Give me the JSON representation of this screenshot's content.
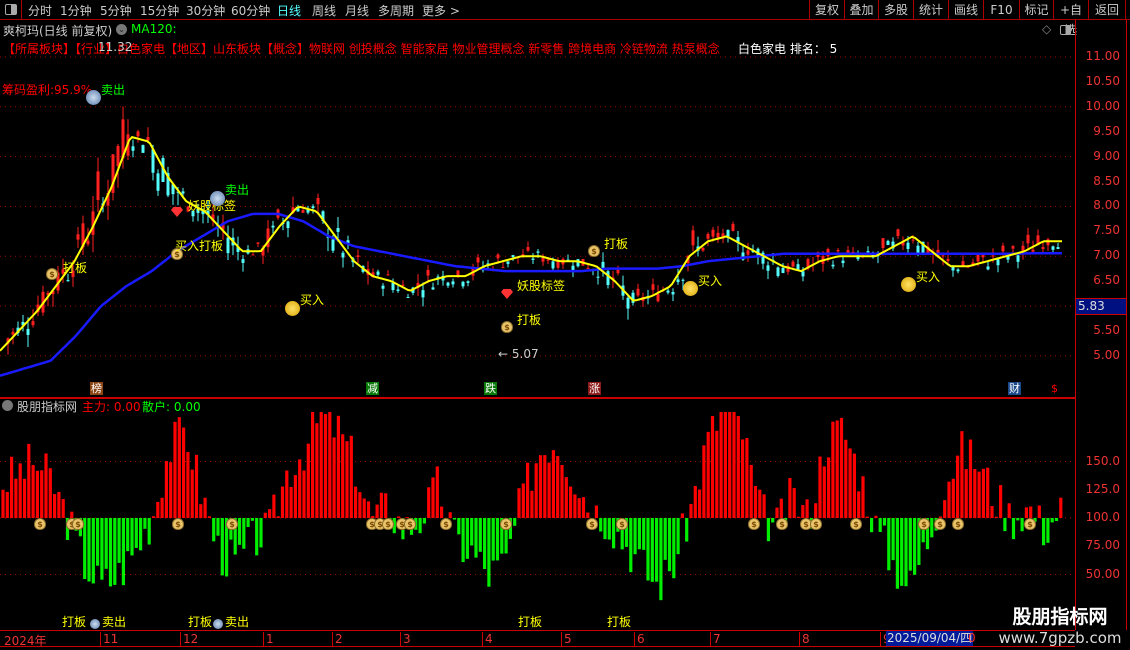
{
  "toolbar": {
    "tabs": [
      "分时",
      "1分钟",
      "5分钟",
      "15分钟",
      "30分钟",
      "60分钟",
      "日线",
      "周线",
      "月线",
      "多周期",
      "更多 >"
    ],
    "active_tab": "日线",
    "buttons": [
      "复权",
      "叠加",
      "多股",
      "统计",
      "画线",
      "F10",
      "标记",
      "+自选",
      "返回"
    ]
  },
  "header": {
    "title": "爽柯玛(日线 前复权)",
    "ma_label": "MA120:",
    "concepts": "【所属板块】【行业】白色家电【地区】山东板块【概念】物联网 创投概念 智能家居 物业管理概念 新零售 跨境电商 冷链物流 热泵概念",
    "rank": "白色家电 排名： 5",
    "high_label": "11.32"
  },
  "main_chart": {
    "price_ticks": [
      "11.00",
      "10.50",
      "10.00",
      "9.50",
      "9.00",
      "8.50",
      "8.00",
      "7.50",
      "7.00",
      "6.50",
      "5.50",
      "5.00"
    ],
    "current_price": "5.83",
    "low_label": "← 5.07",
    "chip_profit": "筹码盈利:95.9%",
    "ma_short": [
      5.1,
      5.5,
      5.9,
      6.4,
      6.9,
      7.6,
      8.4,
      9.4,
      9.3,
      8.6,
      8.1,
      7.9,
      7.5,
      7.1,
      7.1,
      7.6,
      8.0,
      7.9,
      7.4,
      6.9,
      6.6,
      6.5,
      6.3,
      6.5,
      6.6,
      6.6,
      6.8,
      6.9,
      7.0,
      7.0,
      6.9,
      6.9,
      6.8,
      6.5,
      6.1,
      6.2,
      6.4,
      7.0,
      7.3,
      7.4,
      7.2,
      7.0,
      6.8,
      6.7,
      6.9,
      7.0,
      7.0,
      7.0,
      7.2,
      7.4,
      7.1,
      6.8,
      6.8,
      6.9,
      7.0,
      7.1,
      7.3,
      7.3
    ],
    "ma120": [
      4.6,
      4.75,
      4.9,
      5.4,
      6.0,
      6.4,
      6.7,
      7.1,
      7.4,
      7.7,
      7.85,
      7.85,
      7.7,
      7.4,
      7.2,
      7.1,
      7.0,
      6.9,
      6.8,
      6.75,
      6.7,
      6.7,
      6.7,
      6.7,
      6.75,
      6.75,
      6.75,
      6.8,
      6.9,
      6.95,
      7.0,
      7.05,
      7.05,
      7.05,
      7.05,
      7.05,
      7.05,
      7.05,
      7.05,
      7.05,
      7.05,
      7.06,
      7.06
    ],
    "annotations": [
      {
        "text": "卖出",
        "color": "#0f0"
      },
      {
        "text": "打板",
        "color": "#ff0"
      },
      {
        "text": "妖股标签",
        "color": "#ff0"
      },
      {
        "text": "买入打板",
        "color": "#ff0"
      },
      {
        "text": "卖出",
        "color": "#0f0"
      },
      {
        "text": "买入",
        "color": "#ff0"
      },
      {
        "text": "妖股标签",
        "color": "#ff0"
      },
      {
        "text": "打板",
        "color": "#ff0"
      },
      {
        "text": "打板",
        "color": "#ff0"
      },
      {
        "text": "买入",
        "color": "#ff0"
      },
      {
        "text": "买入",
        "color": "#ff0"
      }
    ],
    "event_marks": [
      {
        "text": "榜",
        "color": "#8b4513"
      },
      {
        "text": "减",
        "color": "#087a08"
      },
      {
        "text": "跌",
        "color": "#087a08"
      },
      {
        "text": "涨",
        "color": "#8b1a1a"
      },
      {
        "text": "财",
        "color": "#1a4a8b"
      },
      {
        "text": "$",
        "color": "#e00"
      }
    ]
  },
  "sub_chart": {
    "name": "股朋指标网",
    "main_label": "主力:",
    "main_value": "0.00",
    "retail_label": "散户:",
    "retail_value": "0.00",
    "ticks": [
      "150.0",
      "125.0",
      "100.0",
      "75.00",
      "50.00"
    ],
    "indicator": [
      130,
      140,
      150,
      135,
      100,
      60,
      40,
      50,
      70,
      100,
      160,
      180,
      120,
      70,
      60,
      80,
      90,
      140,
      160,
      190,
      180,
      150,
      100,
      110,
      90,
      100,
      130,
      80,
      70,
      50,
      60,
      120,
      160,
      170,
      140,
      110,
      100,
      80,
      60,
      40,
      60,
      110,
      170,
      200,
      180,
      110,
      90,
      120,
      100,
      170,
      180,
      140,
      90,
      60,
      40,
      80,
      130,
      160,
      150,
      120,
      100,
      110,
      90,
      110
    ]
  },
  "signals_row": [
    "打板",
    "卖出",
    "打板",
    "卖出",
    "打板",
    "打板"
  ],
  "date_axis": {
    "labels": [
      "2024年",
      "11",
      "12",
      "1",
      "2",
      "3",
      "4",
      "5",
      "6",
      "7",
      "8",
      "9"
    ],
    "cursor_date": "2025/09/04/四",
    "tail": "0"
  },
  "watermark": {
    "name": "股朋指标网",
    "url": "www.7gpzb.com"
  },
  "colors": {
    "up": "#ff2020",
    "down": "#54fcfc",
    "ma_short": "#ffff00",
    "ma120": "#1a1aff",
    "sub_up": "#ff0000",
    "sub_down": "#00ee00",
    "grid": "#a00000"
  }
}
